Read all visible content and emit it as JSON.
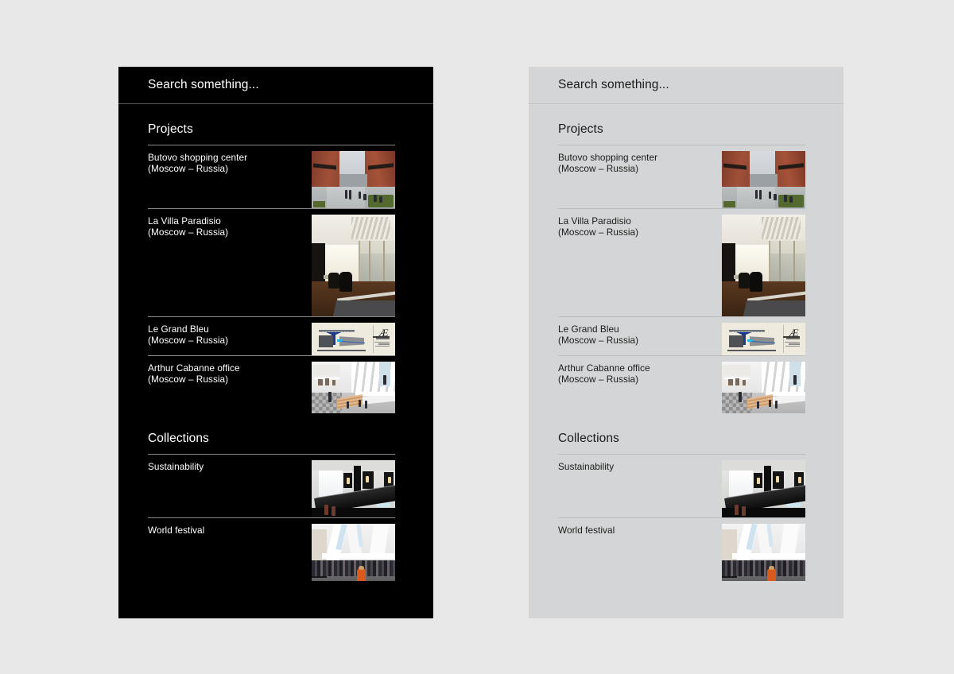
{
  "page": {
    "background_color": "#e8e8e8",
    "variants": [
      {
        "id": "dark",
        "name": "dark-theme-search-panel",
        "bg": "#000000",
        "text": "#ffffff",
        "rule": "#8a8a8a"
      },
      {
        "id": "light",
        "name": "light-theme-search-panel",
        "bg": "#d4d5d6",
        "text": "#1b1b1b",
        "rule": "#bdbebf"
      }
    ]
  },
  "search": {
    "placeholder": "Search something...",
    "value": "Search something..."
  },
  "sections": [
    {
      "title": "Projects",
      "items": [
        {
          "title": "Butovo shopping center",
          "subtitle": "(Moscow – Russia)",
          "thumb": "brick-street-shopping-center",
          "size": "small"
        },
        {
          "title": "La Villa Paradisio",
          "subtitle": "(Moscow – Russia)",
          "thumb": "office-interior-glass",
          "size": "tall"
        },
        {
          "title": "Le Grand Bleu",
          "subtitle": "(Moscow – Russia)",
          "thumb": "architectural-drawing-blue",
          "size": "short"
        },
        {
          "title": "Arthur Cabanne office",
          "subtitle": "(Moscow – Russia)",
          "thumb": "museum-atrium-vaults",
          "size": "med"
        }
      ]
    },
    {
      "title": "Collections",
      "items": [
        {
          "title": "Sustainability",
          "subtitle": "",
          "thumb": "gallery-dark-balustrade",
          "size": "small"
        },
        {
          "title": "World festival",
          "subtitle": "",
          "thumb": "crowded-white-hall",
          "size": "small"
        }
      ]
    }
  ]
}
